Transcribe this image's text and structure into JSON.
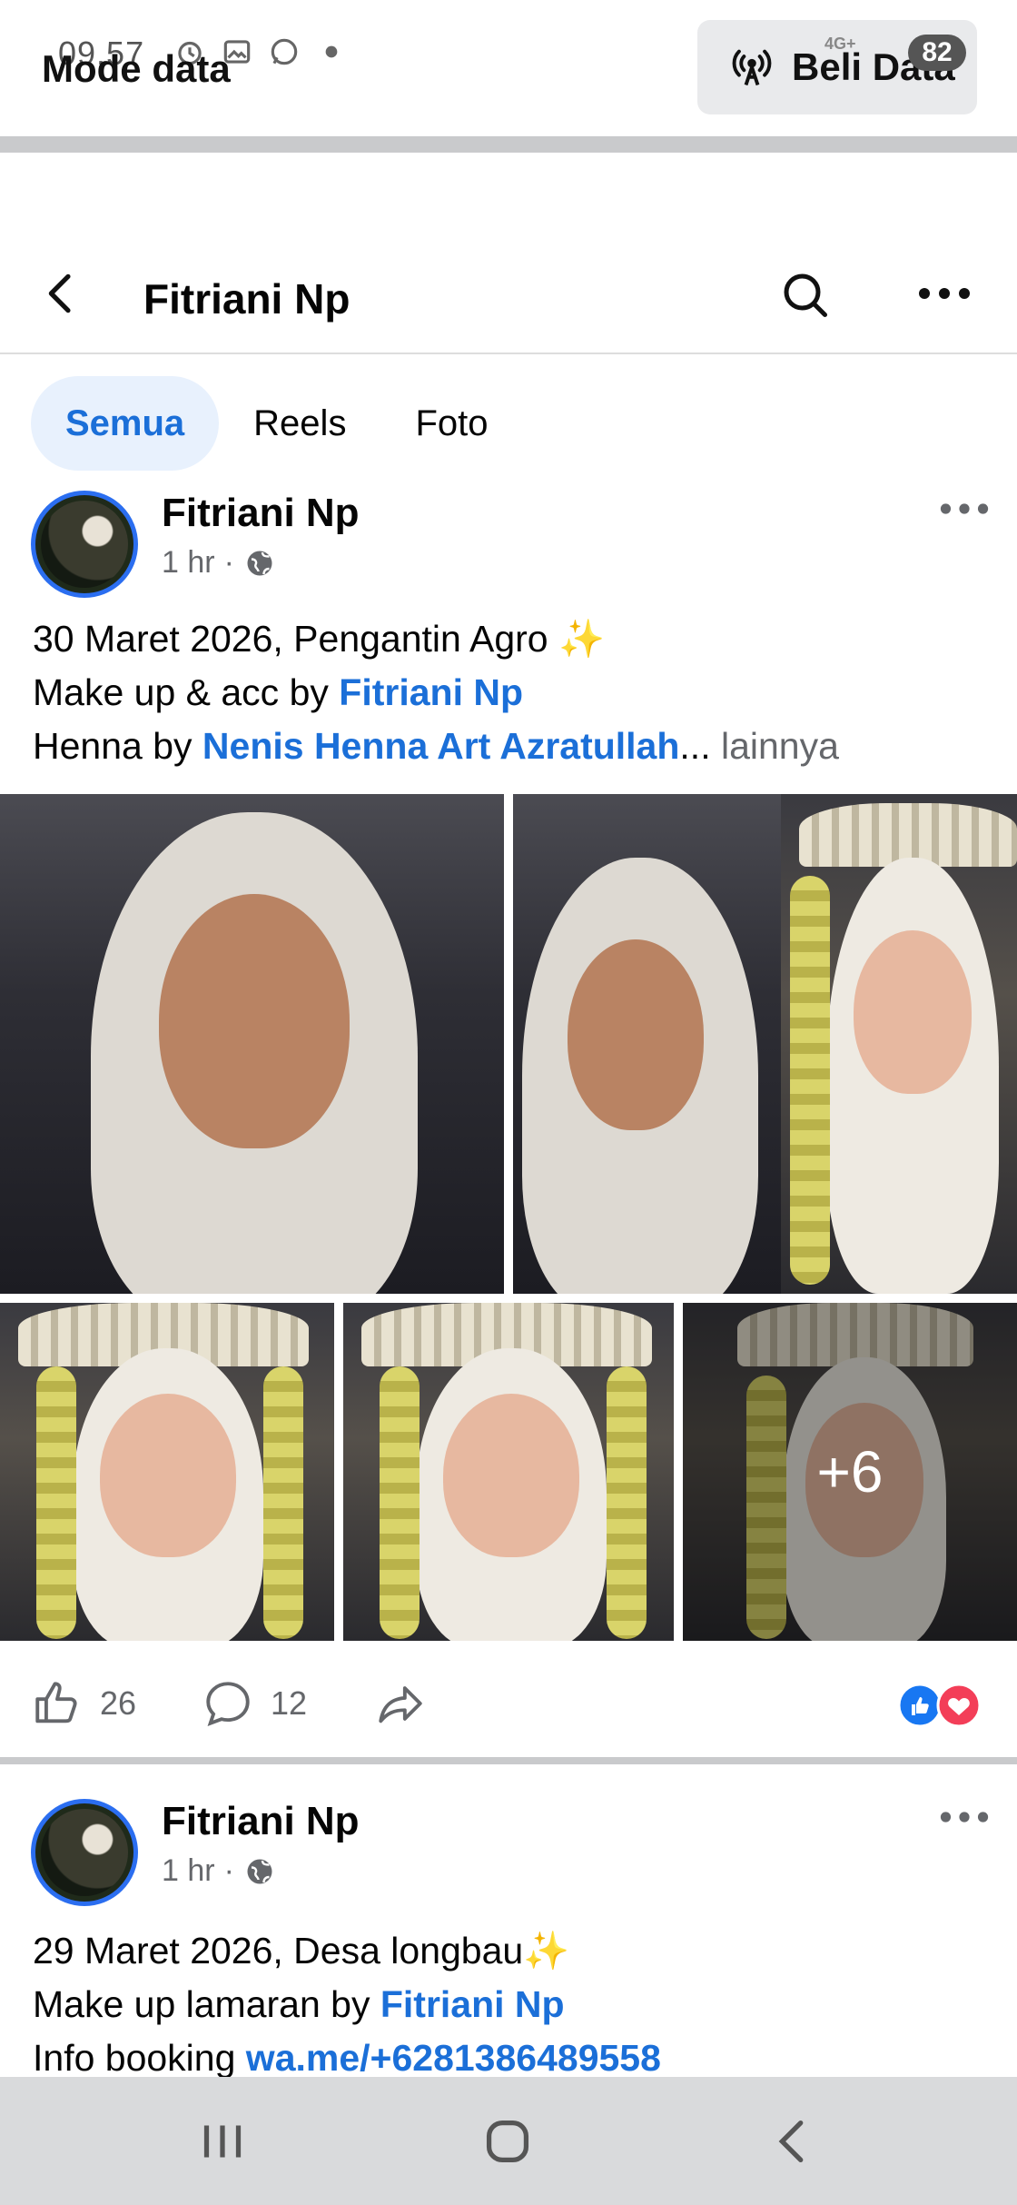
{
  "status": {
    "time": "09.57",
    "network": "4G+",
    "battery": "82"
  },
  "banner": {
    "mode_label": "Mode data",
    "buy_label": "Beli Data"
  },
  "header": {
    "title": "Fitriani Np"
  },
  "tabs": [
    {
      "label": "Semua",
      "active": true
    },
    {
      "label": "Reels",
      "active": false
    },
    {
      "label": "Foto",
      "active": false
    }
  ],
  "posts": [
    {
      "author": "Fitriani Np",
      "time": "1 hr",
      "dot": "·",
      "line1": "30 Maret 2026, Pengantin Agro ",
      "line1_emoji": "✨",
      "line2_prefix": "Make up & acc by ",
      "line2_link": "Fitriani Np",
      "line3_prefix": "Henna by ",
      "line3_link": "Nenis Henna Art Azratullah",
      "ellipsis": "...",
      "more": " lainnya",
      "extra_photos": "+6",
      "likes": "26",
      "comments": "12"
    },
    {
      "author": "Fitriani Np",
      "time": "1 hr",
      "dot": "·",
      "line1": "29 Maret 2026, Desa longbau",
      "line1_emoji": "✨",
      "line2_prefix": "Make up lamaran by ",
      "line2_link": "Fitriani Np",
      "line3_prefix": "Info booking ",
      "line3_link": "wa.me/+6281386489558"
    }
  ],
  "colors": {
    "accent": "#1b6fd8",
    "tab_active_bg": "#e8f1fd",
    "secondary_text": "#65676b",
    "like_blue": "#1877f2",
    "love_red": "#f33e58"
  }
}
